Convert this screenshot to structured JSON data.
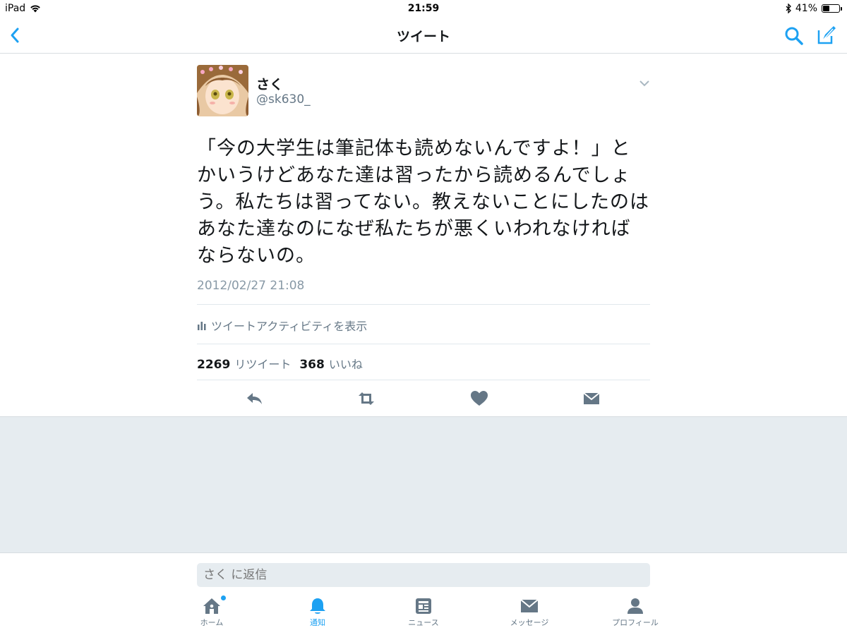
{
  "status_bar": {
    "device": "iPad",
    "time": "21:59",
    "battery_percent": "41%",
    "battery_level": 0.41
  },
  "nav": {
    "title": "ツイート"
  },
  "tweet": {
    "name": "さく",
    "handle": "@sk630_",
    "text": "「今の大学生は筆記体も読めないんですよ！」とかいうけどあなた達は習ったから読めるんでしょう。私たちは習ってない。教えないことにしたのはあなた達なのになぜ私たちが悪くいわれなければならないの。",
    "timestamp": "2012/02/27 21:08",
    "activity_label": "ツイートアクティビティを表示",
    "retweet_count": "2269",
    "retweet_label": "リツイート",
    "like_count": "368",
    "like_label": "いいね"
  },
  "reply": {
    "placeholder": "さく に返信"
  },
  "tabs": [
    {
      "label": "ホーム",
      "icon": "home-icon"
    },
    {
      "label": "通知",
      "icon": "bell-icon"
    },
    {
      "label": "ニュース",
      "icon": "news-icon"
    },
    {
      "label": "メッセージ",
      "icon": "envelope-icon"
    },
    {
      "label": "プロフィール",
      "icon": "person-icon"
    }
  ],
  "colors": {
    "accent": "#1da1f2",
    "secondary_text": "#657786",
    "icon_gray": "#657786",
    "background_gray": "#e6ecf0"
  }
}
